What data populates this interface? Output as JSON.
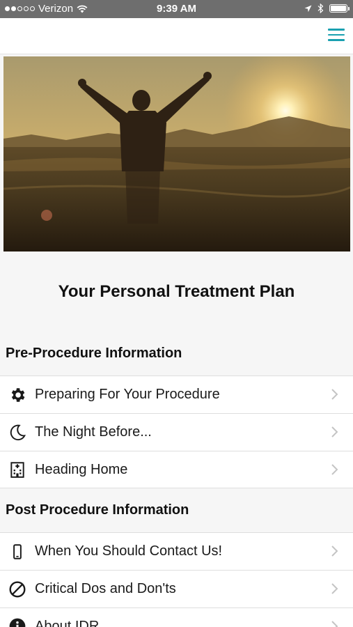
{
  "status_bar": {
    "carrier": "Verizon",
    "time": "9:39 AM",
    "battery_level": 1.0
  },
  "header": {
    "menu_icon": "hamburger-menu-icon",
    "accent_color": "#1aa0b0"
  },
  "hero": {
    "image": "person-arms-raised-in-field-at-sunset"
  },
  "page_title": "Your Personal Treatment Plan",
  "sections": [
    {
      "title": "Pre-Procedure Information",
      "items": [
        {
          "label": "Preparing For Your Procedure",
          "icon": "gear-icon"
        },
        {
          "label": "The Night Before...",
          "icon": "moon-icon"
        },
        {
          "label": "Heading Home",
          "icon": "hospital-building-icon"
        }
      ]
    },
    {
      "title": "Post Procedure Information",
      "items": [
        {
          "label": "When You Should Contact Us!",
          "icon": "mobile-phone-icon"
        },
        {
          "label": "Critical Dos and Don'ts",
          "icon": "prohibited-icon"
        },
        {
          "label": "About IDR",
          "icon": "info-icon"
        }
      ]
    }
  ]
}
